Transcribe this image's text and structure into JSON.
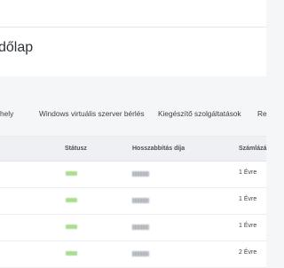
{
  "page": {
    "title": "dőlap"
  },
  "tabs": [
    {
      "label": "hely"
    },
    {
      "label": "Windows virtuális szerver bérlés"
    },
    {
      "label": "Kiegészítő szolgáltatások"
    },
    {
      "label": "Re"
    }
  ],
  "table": {
    "headers": {
      "status": "Státusz",
      "price": "Hosszabbítás díja",
      "billing": "Számlázá"
    },
    "rows": [
      {
        "billing": "1 Évre"
      },
      {
        "billing": "1 Évre"
      },
      {
        "billing": "1 Évre"
      },
      {
        "billing": "2 Évre"
      }
    ]
  },
  "colors": {
    "status_chip": "#a9dd8f",
    "header_bg": "#eef0f3",
    "page_bg": "#f5f6f8"
  }
}
